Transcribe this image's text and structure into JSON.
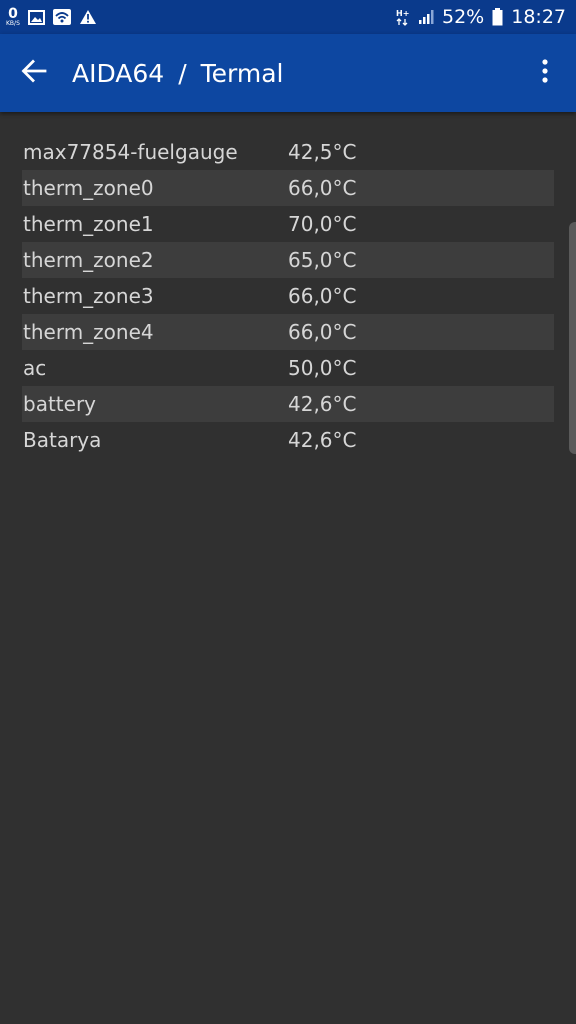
{
  "status_bar": {
    "data_rate_value": "0",
    "data_rate_unit": "KB/S",
    "left_icons": [
      "image-icon",
      "wifi-icon",
      "warning-icon"
    ],
    "network_type": "H+",
    "battery_percent": "52%",
    "time": "18:27"
  },
  "app_bar": {
    "app_name": "AIDA64",
    "separator": "/",
    "page_title": "Termal",
    "back_icon": "arrow-left-icon",
    "menu_icon": "more-vert-icon"
  },
  "sensors": [
    {
      "name": "max77854-fuelgauge",
      "value": "42,5°C"
    },
    {
      "name": "therm_zone0",
      "value": "66,0°C"
    },
    {
      "name": "therm_zone1",
      "value": "70,0°C"
    },
    {
      "name": "therm_zone2",
      "value": "65,0°C"
    },
    {
      "name": "therm_zone3",
      "value": "66,0°C"
    },
    {
      "name": "therm_zone4",
      "value": "66,0°C"
    },
    {
      "name": "ac",
      "value": "50,0°C"
    },
    {
      "name": "battery",
      "value": "42,6°C"
    },
    {
      "name": "Batarya",
      "value": "42,6°C"
    }
  ],
  "colors": {
    "status_bar": "#0a3a8c",
    "app_bar": "#0d47a1",
    "background": "#303030",
    "row_alt": "#3d3d3d",
    "text": "#d6d6d6"
  }
}
